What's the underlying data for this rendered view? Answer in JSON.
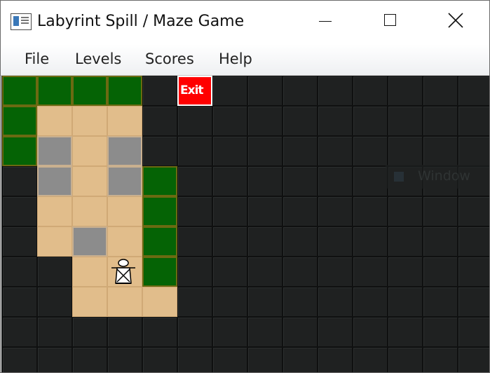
{
  "window": {
    "title": "Labyrint Spill / Maze Game"
  },
  "menu": {
    "items": [
      "File",
      "Levels",
      "Scores",
      "Help"
    ]
  },
  "board": {
    "columns": 14,
    "rows": 10,
    "legend": {
      "D": "dark-floor",
      "G": "grass",
      "S": "sand",
      "R": "stone",
      "E": "exit"
    },
    "map": [
      "GGGGDEDDDDDDDD",
      "GSSSDDDDDDDDDD",
      "GRSRDDDDDDDDDD",
      "DRSRGDDDDDDDDD",
      "DSSSGDDDDDDDDD",
      "DSRSGDDDDDDDDD",
      "DDSSGDDDDDDDDD",
      "DDSSSDDDDDDDDD",
      "DDDDDDDDDDDDDD",
      "DDDDDDDDDDDDDD"
    ],
    "exit_label": "Exit",
    "player": {
      "column": 3,
      "row": 6
    }
  },
  "background_ghost": {
    "text": "Window"
  },
  "colors": {
    "grass": "#056305",
    "sand": "#e1bd8b",
    "stone": "#8c8c8c",
    "exit": "#ff0000",
    "floor": "#1f2121"
  }
}
